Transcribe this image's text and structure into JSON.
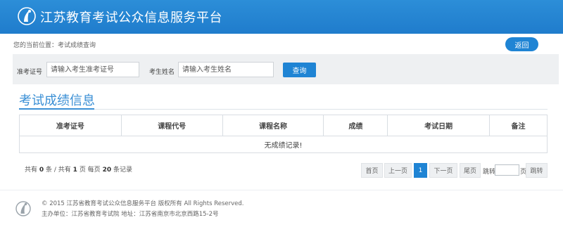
{
  "header": {
    "title": "江苏教育考试公众信息服务平台",
    "logo_icon": "exam-logo-icon"
  },
  "breadcrumb": {
    "text": "您的当前位置：考试成绩查询"
  },
  "back_label": "返回",
  "search": {
    "exam_no_label": "准考证号",
    "exam_no_placeholder": "请输入考生准考证号",
    "name_label": "考生姓名",
    "name_placeholder": "请输入考生姓名",
    "query_label": "查询"
  },
  "section_title": "考试成绩信息",
  "table": {
    "columns": [
      "准考证号",
      "课程代号",
      "课程名称",
      "成绩",
      "考试日期",
      "备注"
    ],
    "empty_message": "无成绩记录!"
  },
  "pagination": {
    "summary_prefix": "共有",
    "total_records": "0",
    "summary_mid1": "条 / 共有",
    "total_pages": "1",
    "summary_mid2": "页 每页",
    "per_page": "20",
    "summary_suffix": "条记录",
    "first": "首页",
    "prev": "上一页",
    "current": "1",
    "next": "下一页",
    "last": "尾页",
    "jump_label": "跳转",
    "page_unit": "页",
    "jump_button": "跳转"
  },
  "footer": {
    "copyright": "© 2015 江苏省教育考试公众信息服务平台 版权所有 All Rights Reserved.",
    "address": "主办单位：江苏省教育考试院 地址：江苏省南京市北京西路15-2号"
  },
  "colors": {
    "header_blue": "#1f84d4",
    "title_blue": "#3a8fd5",
    "panel_gray": "#eef0f2"
  }
}
